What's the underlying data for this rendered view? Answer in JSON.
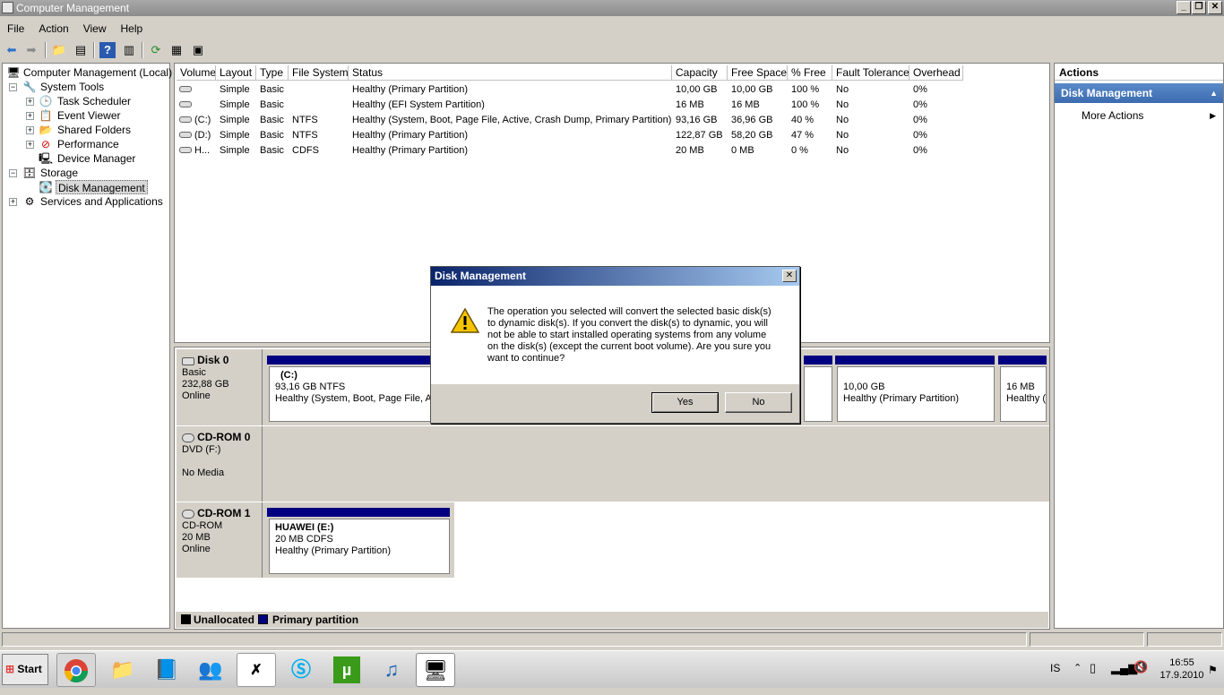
{
  "window": {
    "title": "Computer Management"
  },
  "menu": [
    "File",
    "Action",
    "View",
    "Help"
  ],
  "tree": {
    "root": "Computer Management (Local)",
    "system_tools": "System Tools",
    "task_scheduler": "Task Scheduler",
    "event_viewer": "Event Viewer",
    "shared_folders": "Shared Folders",
    "performance": "Performance",
    "device_manager": "Device Manager",
    "storage": "Storage",
    "disk_management": "Disk Management",
    "services": "Services and Applications"
  },
  "volumes": {
    "columns": [
      "Volume",
      "Layout",
      "Type",
      "File System",
      "Status",
      "Capacity",
      "Free Space",
      "% Free",
      "Fault Tolerance",
      "Overhead"
    ],
    "rows": [
      [
        "",
        "Simple",
        "Basic",
        "",
        "Healthy (Primary Partition)",
        "10,00 GB",
        "10,00 GB",
        "100 %",
        "No",
        "0%"
      ],
      [
        "",
        "Simple",
        "Basic",
        "",
        "Healthy (EFI System Partition)",
        "16 MB",
        "16 MB",
        "100 %",
        "No",
        "0%"
      ],
      [
        "(C:)",
        "Simple",
        "Basic",
        "NTFS",
        "Healthy (System, Boot, Page File, Active, Crash Dump, Primary Partition)",
        "93,16 GB",
        "36,96 GB",
        "40 %",
        "No",
        "0%"
      ],
      [
        "(D:)",
        "Simple",
        "Basic",
        "NTFS",
        "Healthy (Primary Partition)",
        "122,87 GB",
        "58,20 GB",
        "47 %",
        "No",
        "0%"
      ],
      [
        "H...",
        "Simple",
        "Basic",
        "CDFS",
        "Healthy (Primary Partition)",
        "20 MB",
        "0 MB",
        "0 %",
        "No",
        "0%"
      ]
    ]
  },
  "disks": {
    "disk0": {
      "name": "Disk 0",
      "type": "Basic",
      "size": "232,88 GB",
      "status": "Online",
      "p1_name": "(C:)",
      "p1_size": "93,16 GB NTFS",
      "p1_status": "Healthy (System, Boot, Page File, Ac",
      "p3_size": "10,00 GB",
      "p3_status": "Healthy (Primary Partition)",
      "p4_size": "16 MB",
      "p4_status": "Healthy ("
    },
    "cdrom0": {
      "name": "CD-ROM 0",
      "type": "DVD (F:)",
      "status": "No Media"
    },
    "cdrom1": {
      "name": "CD-ROM 1",
      "type": "CD-ROM",
      "size": "20 MB",
      "status": "Online",
      "p_name": "HUAWEI  (E:)",
      "p_size": "20 MB CDFS",
      "p_status": "Healthy (Primary Partition)"
    }
  },
  "legend": {
    "unallocated": "Unallocated",
    "primary": "Primary partition"
  },
  "actions": {
    "header": "Actions",
    "section": "Disk Management",
    "more": "More Actions"
  },
  "dialog": {
    "title": "Disk Management",
    "lines": [
      "The operation you selected will convert the selected basic disk(s)",
      "to dynamic disk(s). If you convert the disk(s) to dynamic, you will",
      "not be able to start installed operating systems from any volume",
      "on the disk(s) (except the current boot volume). Are you sure you",
      "want to continue?"
    ],
    "yes": "Yes",
    "no": "No"
  },
  "taskbar": {
    "start": "Start",
    "lang": "IS",
    "time": "16:55",
    "date": "17.9.2010"
  },
  "colors": {
    "primary_partition": "#000080",
    "unallocated": "#000000",
    "dialog_title_start": "#0a246a"
  }
}
